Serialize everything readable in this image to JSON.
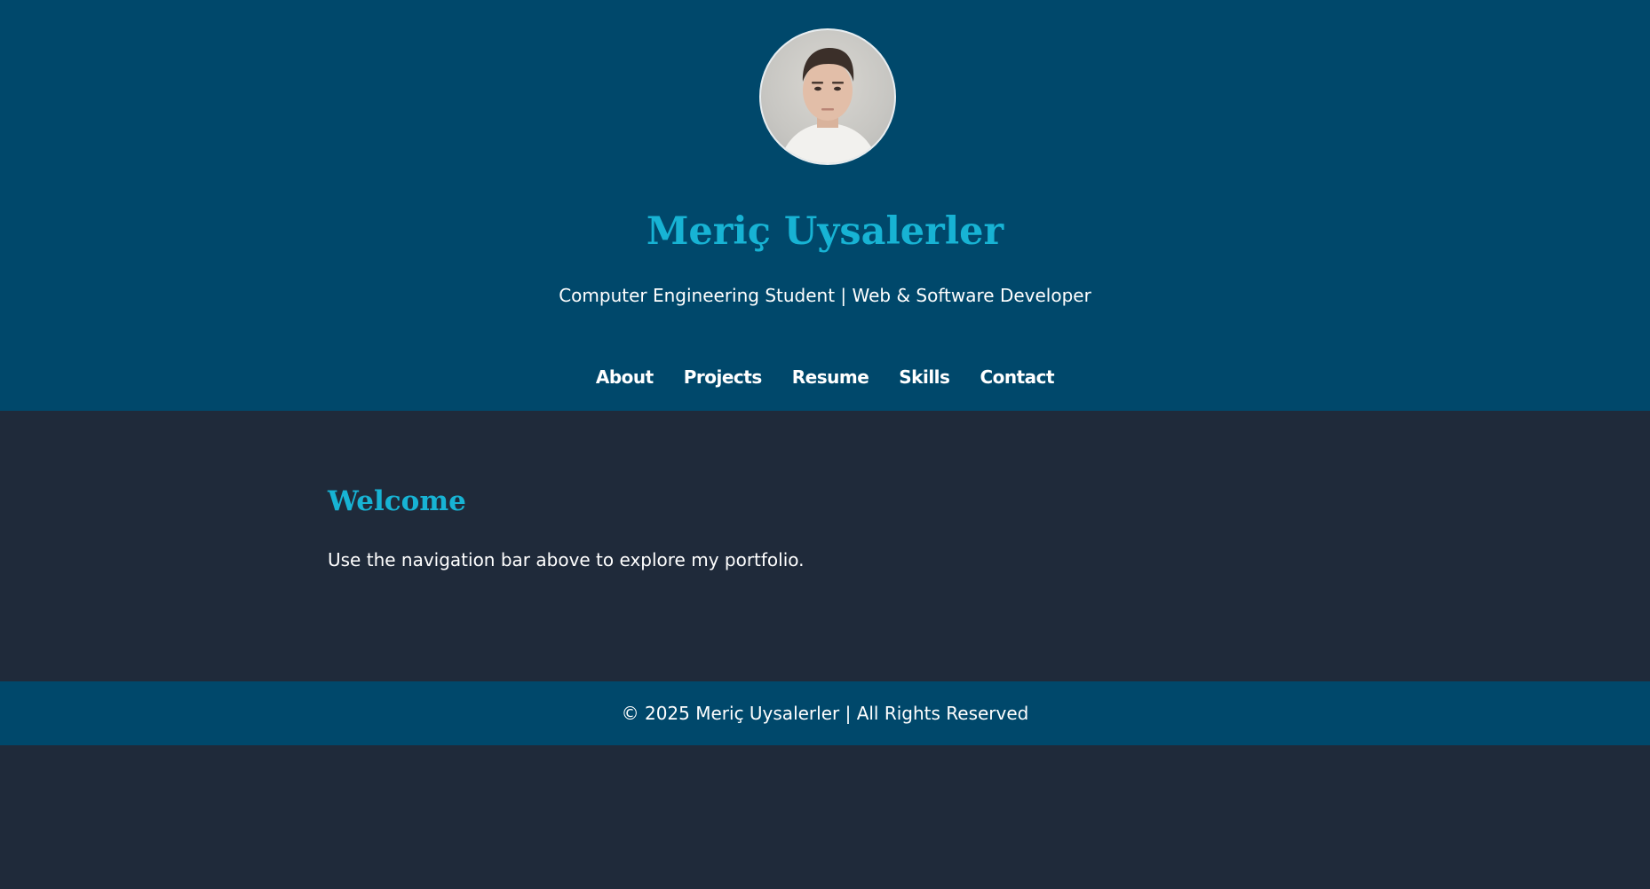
{
  "header": {
    "name": "Meriç Uysalerler",
    "tagline": "Computer Engineering Student | Web & Software Developer",
    "avatar_icon": "profile-photo"
  },
  "nav": {
    "items": [
      {
        "label": "About"
      },
      {
        "label": "Projects"
      },
      {
        "label": "Resume"
      },
      {
        "label": "Skills"
      },
      {
        "label": "Contact"
      }
    ]
  },
  "main": {
    "title": "Welcome",
    "text": "Use the navigation bar above to explore my portfolio."
  },
  "footer": {
    "text": "© 2025 Meriç Uysalerler | All Rights Reserved"
  },
  "colors": {
    "header_bg": "#00486b",
    "page_bg": "#1f2a3a",
    "accent": "#17b3d4",
    "text": "#ffffff"
  }
}
